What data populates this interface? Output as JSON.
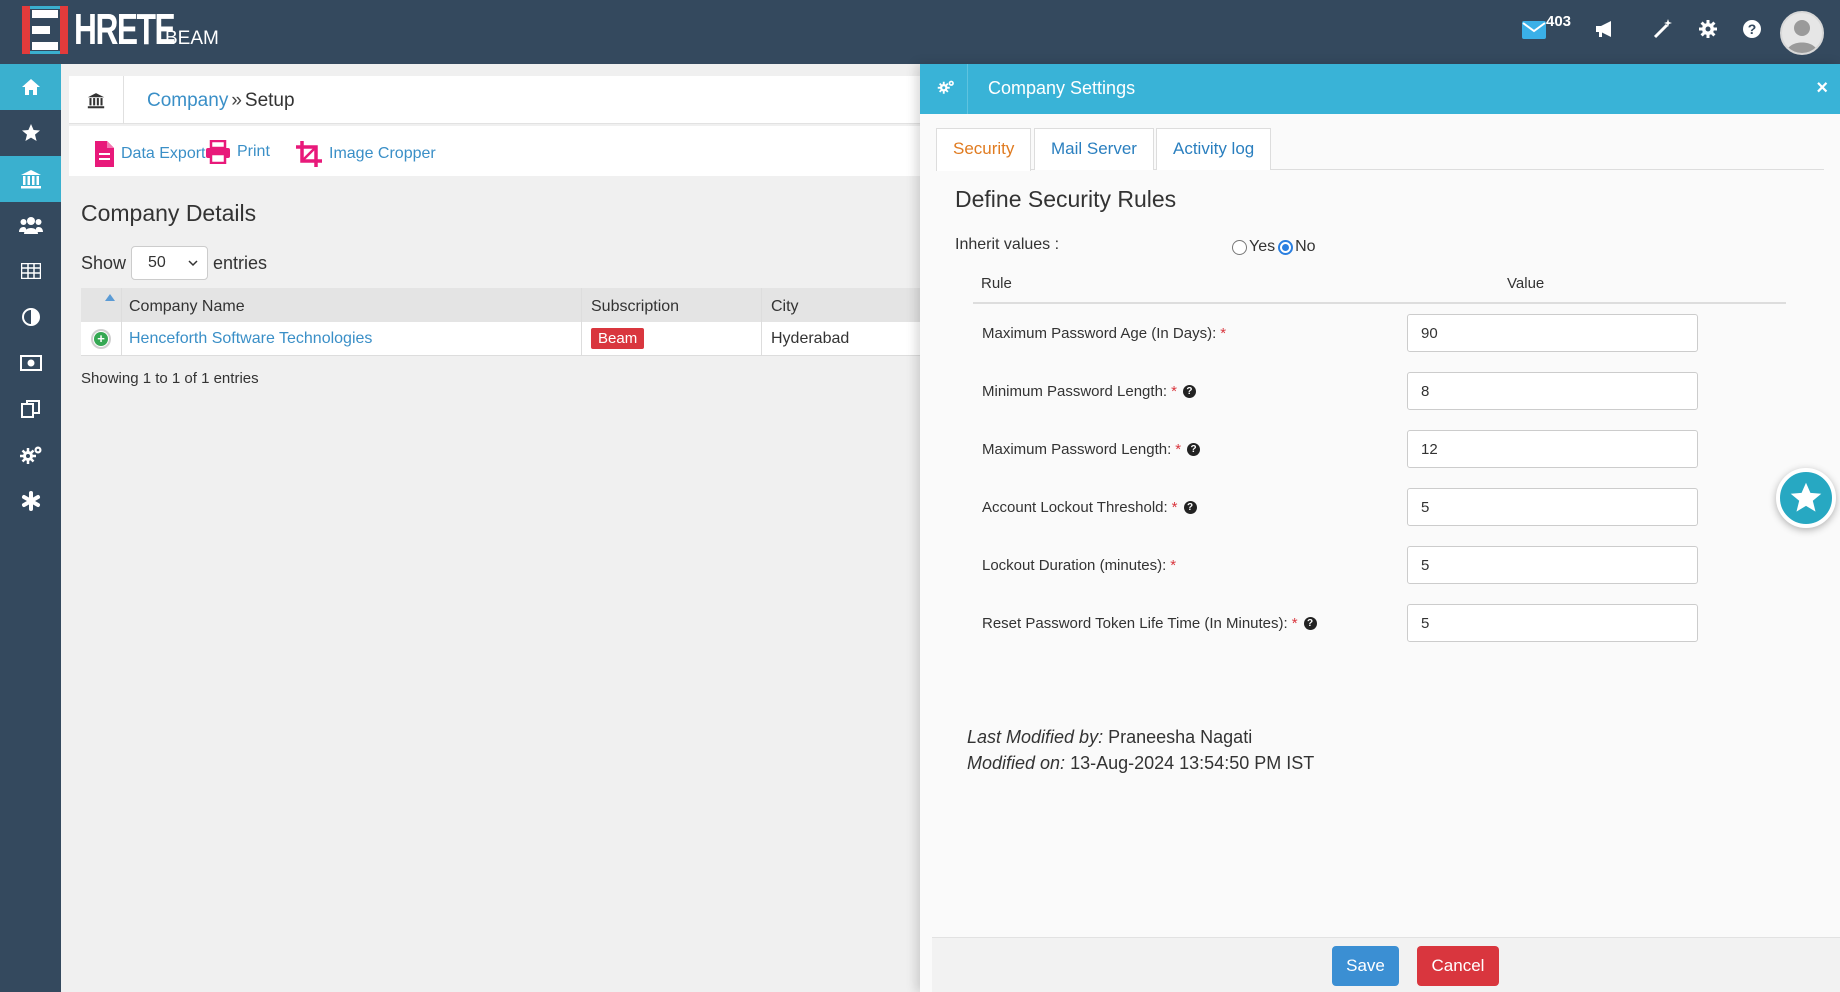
{
  "app": {
    "logo_text": "HRETE",
    "name": "BEAM"
  },
  "topbar": {
    "mail_count": "403"
  },
  "breadcrumb": {
    "link": "Company",
    "separator": "»",
    "current": "Setup"
  },
  "toolbar": {
    "data_export": "Data Export",
    "print": "Print",
    "image_cropper": "Image Cropper"
  },
  "company": {
    "title": "Company Details",
    "show_label": "Show",
    "entries_value": "50",
    "entries_label": "entries",
    "columns": [
      "Company Name",
      "Subscription",
      "City"
    ],
    "rows": [
      {
        "name": "Henceforth Software Technologies",
        "subscription": "Beam",
        "city": "Hyderabad"
      }
    ],
    "footer": "Showing 1 to 1 of 1 entries"
  },
  "modal": {
    "title": "Company Settings",
    "close": "×",
    "tabs": [
      "Security",
      "Mail Server",
      "Activity log"
    ],
    "section_title": "Define Security Rules",
    "inherit_label": "Inherit values :",
    "inherit_yes": "Yes",
    "inherit_no": "No",
    "inherit_selected": "No",
    "col_rule": "Rule",
    "col_value": "Value",
    "rules": [
      {
        "label": "Maximum Password Age (In Days):",
        "value": "90",
        "required": "*",
        "help": ""
      },
      {
        "label": "Minimum Password Length:",
        "value": "8",
        "required": "*",
        "help": "?"
      },
      {
        "label": "Maximum Password Length:",
        "value": "12",
        "required": "*",
        "help": "?"
      },
      {
        "label": "Account Lockout Threshold:",
        "value": "5",
        "required": "*",
        "help": "?"
      },
      {
        "label": "Lockout Duration (minutes):",
        "value": "5",
        "required": "*",
        "help": ""
      },
      {
        "label": "Reset Password Token Life Time (In Minutes):",
        "value": "5",
        "required": "*",
        "help": "?"
      }
    ],
    "last_modified_by_label": "Last Modified by:",
    "last_modified_by": "Praneesha Nagati",
    "modified_on_label": "Modified on:",
    "modified_on": "13-Aug-2024 13:54:50 PM IST",
    "save": "Save",
    "cancel": "Cancel"
  },
  "colors": {
    "topbar": "#34495e",
    "accent": "#39b3d7",
    "danger": "#d9363e",
    "primary": "#3b8fd3",
    "link": "#3a8fc7",
    "tool_icon": "#e8197a"
  }
}
